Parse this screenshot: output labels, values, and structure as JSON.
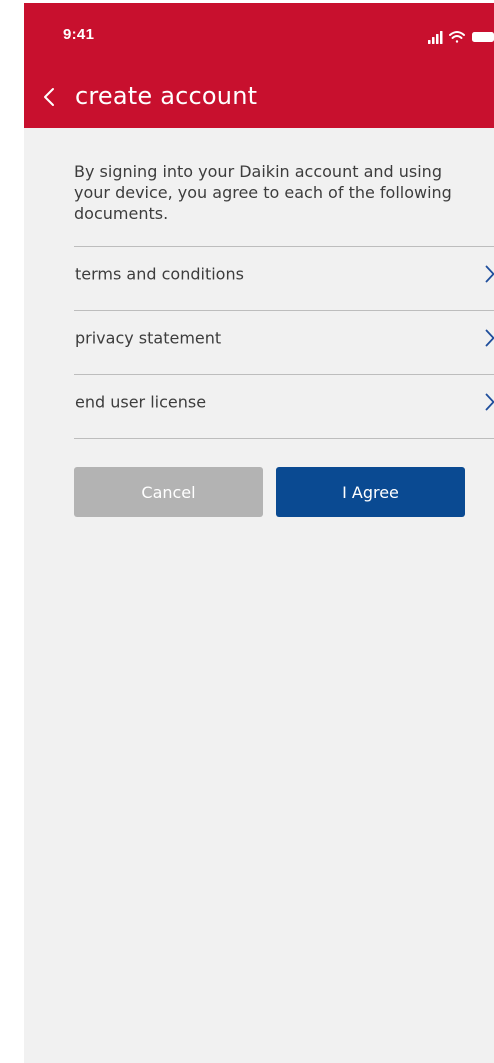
{
  "status_bar": {
    "time": "9:41",
    "icons": [
      "signal-icon",
      "wifi-icon",
      "battery-icon"
    ]
  },
  "header": {
    "back_icon": "chevron-left-icon",
    "title": "create account"
  },
  "main": {
    "intro": "By signing into your Daikin account and using your device, you agree to each of the following documents.",
    "documents": [
      {
        "label": "terms and conditions",
        "icon": "chevron-right-icon"
      },
      {
        "label": "privacy statement",
        "icon": "chevron-right-icon"
      },
      {
        "label": "end user license",
        "icon": "chevron-right-icon"
      }
    ]
  },
  "actions": {
    "cancel_label": "Cancel",
    "agree_label": "I Agree"
  },
  "colors": {
    "header": "#c8102e",
    "primary_button": "#0a4a92",
    "secondary_button": "#b3b3b3",
    "background": "#f1f1f1",
    "chevron": "#1f4e9c"
  }
}
